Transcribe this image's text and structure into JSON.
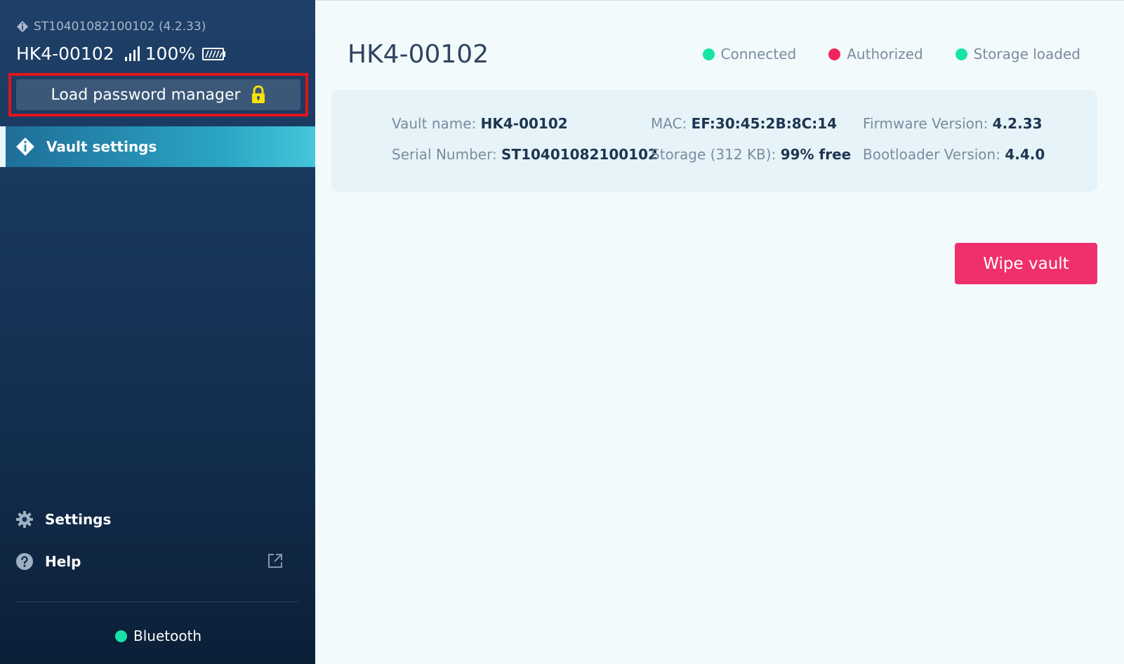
{
  "sidebar": {
    "device_serial_version": "ST10401082100102 (4.2.33)",
    "device_name": "HK4-00102",
    "battery_percent": "100%",
    "load_password_manager_label": "Load password manager",
    "nav": {
      "vault_settings": "Vault settings",
      "settings": "Settings",
      "help": "Help"
    },
    "bluetooth_label": "Bluetooth"
  },
  "main": {
    "title": "HK4-00102",
    "statuses": [
      {
        "label": "Connected",
        "color": "#17e3a6"
      },
      {
        "label": "Authorized",
        "color": "#f0245e"
      },
      {
        "label": "Storage loaded",
        "color": "#17e3a6"
      }
    ],
    "info": {
      "vault_name_label": "Vault name:",
      "vault_name_value": "HK4-00102",
      "serial_label": "Serial Number:",
      "serial_value": "ST10401082100102",
      "mac_label": "MAC:",
      "mac_value": "EF:30:45:2B:8C:14",
      "storage_label": "Storage (312 KB):",
      "storage_value": "99% free",
      "firmware_label": "Firmware Version:",
      "firmware_value": "4.2.33",
      "bootloader_label": "Bootloader Version:",
      "bootloader_value": "4.4.0"
    },
    "wipe_vault_label": "Wipe vault"
  },
  "colors": {
    "accent_teal": "#2ba5c4",
    "status_green": "#17e3a6",
    "status_red": "#f0245e",
    "wipe_button": "#f0306d",
    "lock_icon": "#f5e400",
    "highlight_border": "#e2141c"
  },
  "icons": {
    "device": "diamond-info-icon",
    "signal": "signal-bars-icon",
    "battery": "battery-icon",
    "lock": "lock-icon",
    "vault_settings": "diamond-info-icon",
    "settings": "gear-icon",
    "help": "question-circle-icon",
    "external_link": "external-link-icon"
  }
}
